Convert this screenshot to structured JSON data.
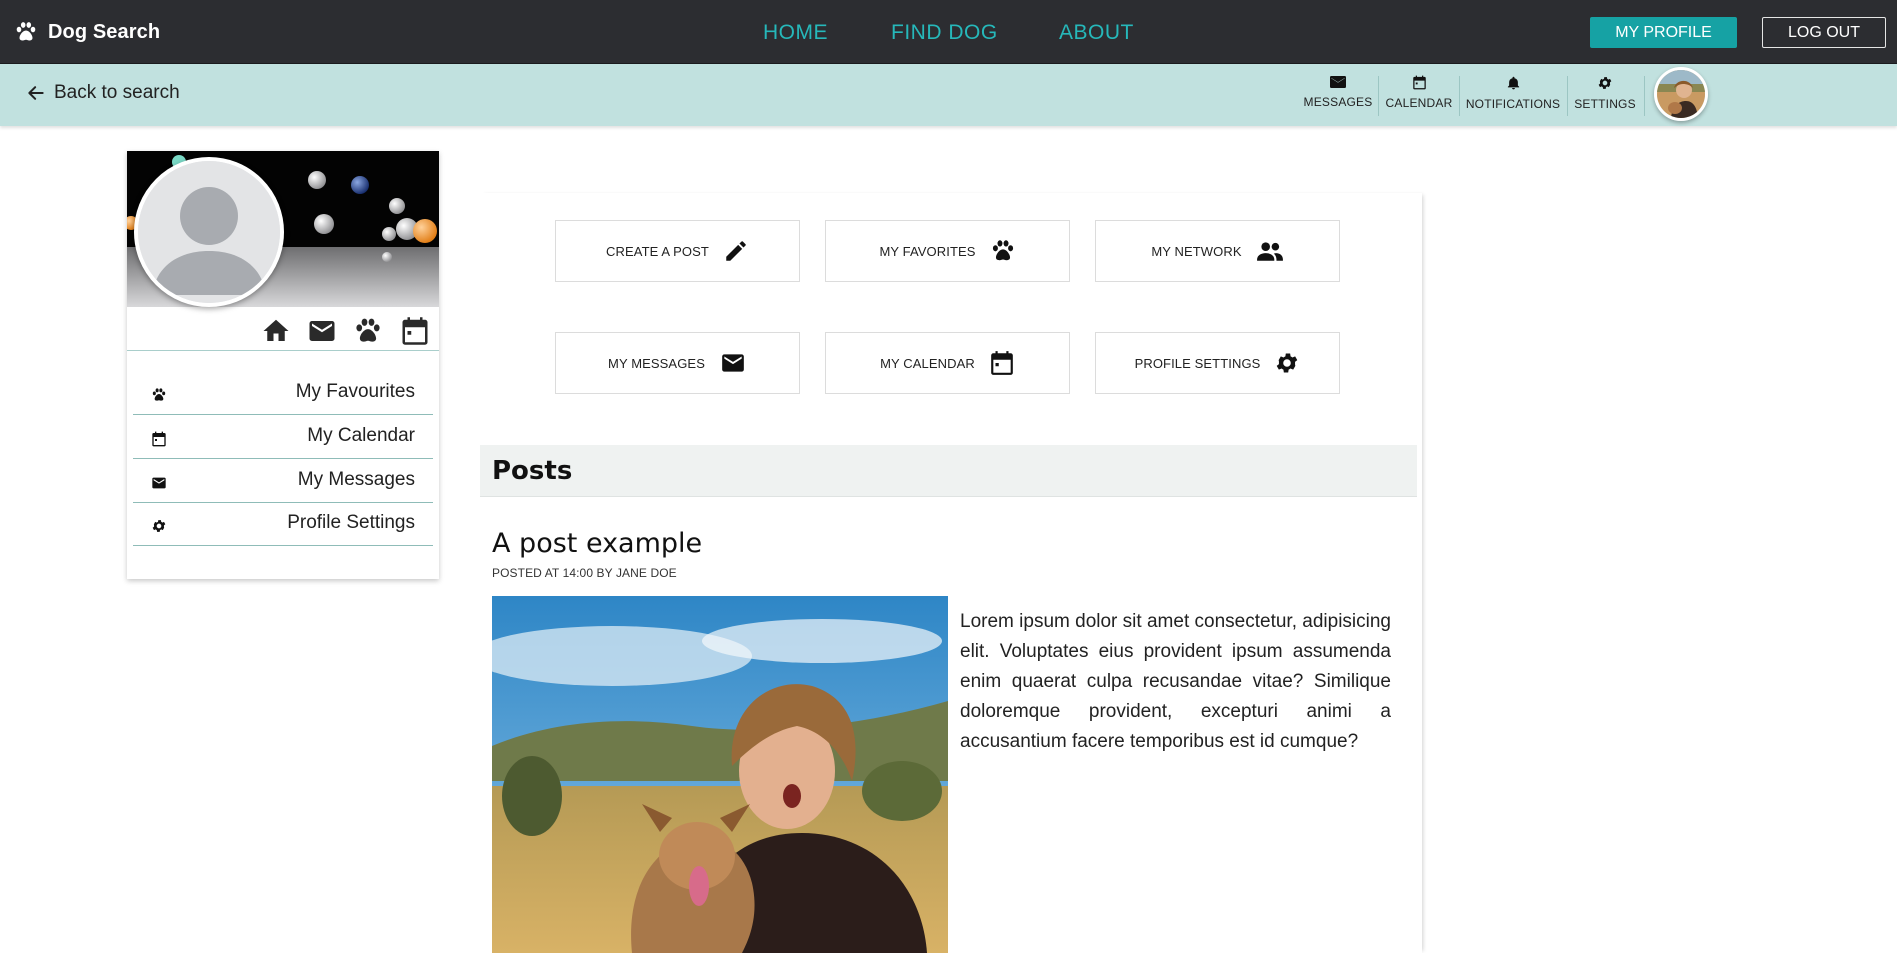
{
  "brand": {
    "name": "Dog Search",
    "icon": "paw-icon"
  },
  "nav": {
    "home": "HOME",
    "find_dog": "FIND DOG",
    "about": "ABOUT"
  },
  "header_buttons": {
    "my_profile": "MY PROFILE",
    "log_out": "LOG OUT"
  },
  "subbar": {
    "back_label": "Back to search",
    "tools": [
      {
        "label": "MESSAGES",
        "icon": "envelope-icon"
      },
      {
        "label": "CALENDAR",
        "icon": "calendar-icon"
      },
      {
        "label": "NOTIFICATIONS",
        "icon": "bell-icon"
      },
      {
        "label": "SETTINGS",
        "icon": "gear-icon"
      }
    ]
  },
  "profile_card": {
    "icons": [
      "home-icon",
      "envelope-icon",
      "paw-icon",
      "calendar-icon"
    ],
    "menu": [
      {
        "label": "My Favourites",
        "icon": "paw-icon"
      },
      {
        "label": "My Calendar",
        "icon": "calendar-icon"
      },
      {
        "label": "My Messages",
        "icon": "envelope-icon"
      },
      {
        "label": "Profile Settings",
        "icon": "gear-icon"
      }
    ]
  },
  "quick_actions": [
    {
      "label": "CREATE A POST",
      "icon": "pencil-icon"
    },
    {
      "label": "MY FAVORITES",
      "icon": "paw-icon"
    },
    {
      "label": "MY NETWORK",
      "icon": "people-icon"
    },
    {
      "label": "MY MESSAGES",
      "icon": "envelope-icon"
    },
    {
      "label": "MY CALENDAR",
      "icon": "calendar-icon"
    },
    {
      "label": "PROFILE SETTINGS",
      "icon": "gear-icon"
    }
  ],
  "posts": {
    "heading": "Posts",
    "items": [
      {
        "title": "A post example",
        "meta": "POSTED AT 14:00 BY JANE DOE",
        "body": "Lorem ipsum dolor sit amet consectetur, adipisicing elit. Voluptates eius provident ipsum assumenda enim quaerat culpa recusandae vitae? Similique doloremque provident, excepturi animi a accusantium facere temporibus est id cumque?"
      }
    ]
  },
  "colors": {
    "navbar": "#2c2d31",
    "accent": "#16a2a4",
    "nav_link": "#26b8ba",
    "subbar": "#c1e1df",
    "posts_bar": "#eff2f1"
  }
}
